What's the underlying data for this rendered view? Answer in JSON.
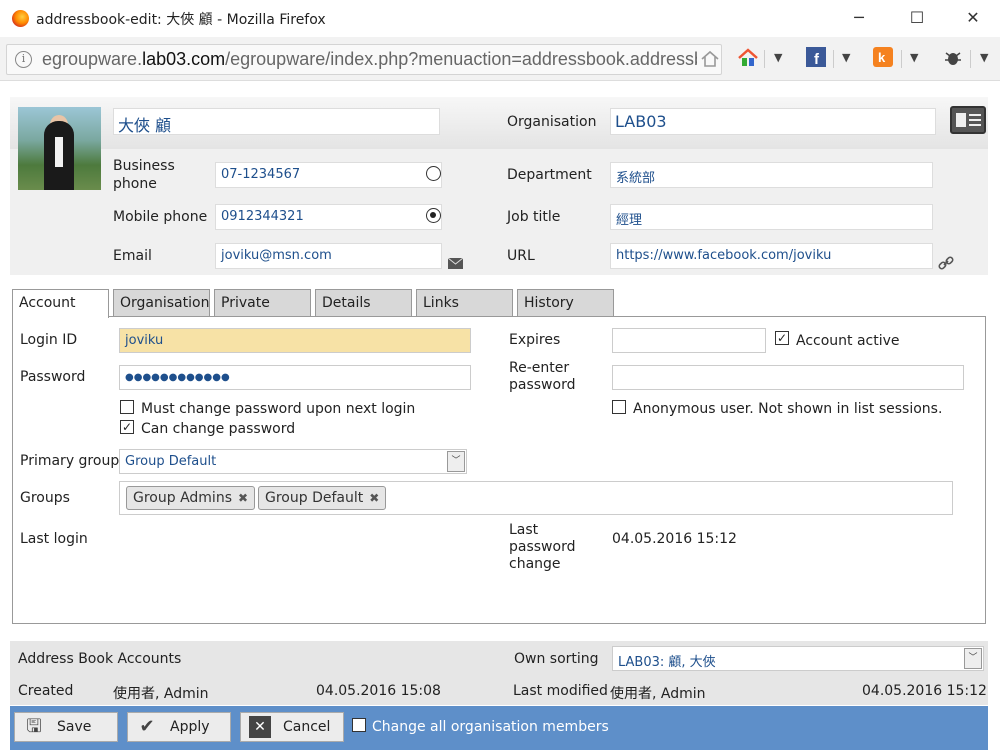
{
  "window": {
    "title": "addressbook-edit: 大俠 顧 - Mozilla Firefox",
    "minimize": "─",
    "maximize": "☐",
    "close": "✕"
  },
  "urlbar": {
    "host_prefix": "egroupware.",
    "host": "lab03.com",
    "path": "/egroupware/index.php?menuaction=addressbook.addressbo"
  },
  "contact": {
    "name": "大俠 顧",
    "organisation_label": "Organisation",
    "organisation": "LAB03",
    "business_phone_label": "Business phone",
    "business_phone": "07-1234567",
    "mobile_phone_label": "Mobile phone",
    "mobile_phone": "0912344321",
    "email_label": "Email",
    "email": "joviku@msn.com",
    "department_label": "Department",
    "department": "系統部",
    "job_title_label": "Job title",
    "job_title": "經理",
    "url_label": "URL",
    "url": "https://www.facebook.com/joviku"
  },
  "tabs": [
    "Account",
    "Organisation",
    "Private",
    "Details",
    "Links",
    "History"
  ],
  "account": {
    "login_id_label": "Login ID",
    "login_id": "joviku",
    "password_label": "Password",
    "password": "●●●●●●●●●●●●",
    "must_change_label": "Must change password upon next login",
    "can_change_label": "Can change password",
    "primary_group_label": "Primary group",
    "primary_group": "Group Default",
    "groups_label": "Groups",
    "groups": [
      "Group Admins",
      "Group Default"
    ],
    "last_login_label": "Last login",
    "expires_label": "Expires",
    "account_active_label": "Account active",
    "reenter_label": "Re-enter password",
    "anonymous_label": "Anonymous user. Not shown in list sessions.",
    "last_pw_change_label": "Last password change",
    "last_pw_change": "04.05.2016 15:12"
  },
  "footer": {
    "addressbook_label": "Address Book Accounts",
    "own_sorting_label": "Own sorting",
    "own_sorting": "LAB03: 顧, 大俠",
    "created_label": "Created",
    "created_by": "使用者, Admin",
    "created_at": "04.05.2016 15:08",
    "modified_label": "Last modified",
    "modified_by": "使用者, Admin",
    "modified_at": "04.05.2016 15:12"
  },
  "buttons": {
    "save": "Save",
    "apply": "Apply",
    "cancel": "Cancel",
    "change_all": "Change all organisation members"
  }
}
